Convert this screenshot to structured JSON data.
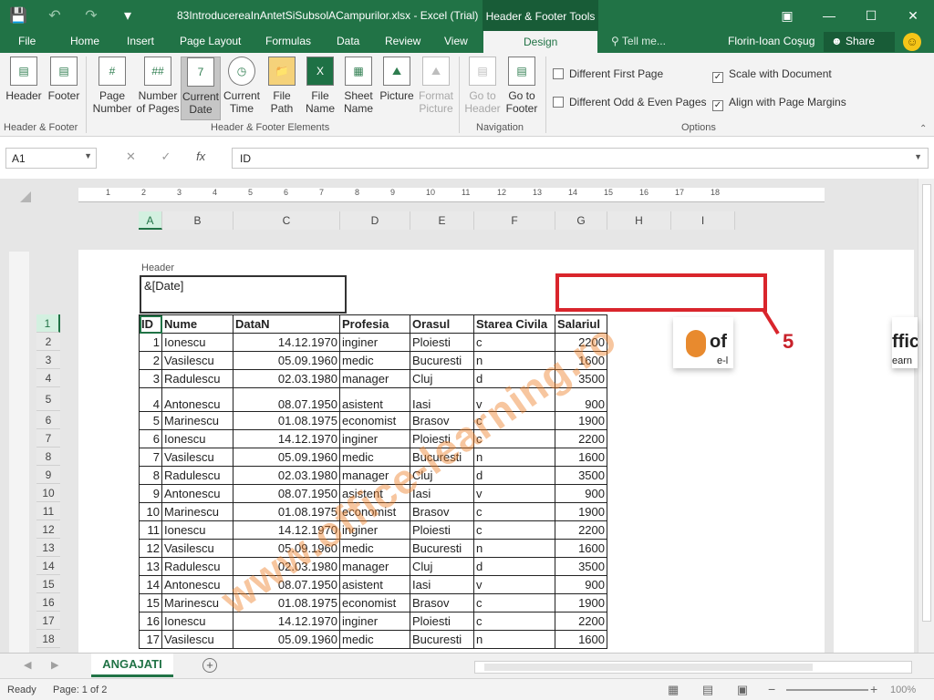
{
  "window": {
    "title": "83IntroducereaInAntetSiSubsolACampurilor.xlsx - Excel (Trial)",
    "contextual_tab": "Header & Footer Tools"
  },
  "tabs": [
    "File",
    "Home",
    "Insert",
    "Page Layout",
    "Formulas",
    "Data",
    "Review",
    "View",
    "Design"
  ],
  "tell_me": "Tell me...",
  "user": "Florin-Ioan Coşug",
  "share": "Share",
  "ribbon": {
    "groups": {
      "hf": "Header & Footer",
      "elements": "Header & Footer Elements",
      "navigation": "Navigation",
      "options": "Options"
    },
    "buttons": {
      "header": "Header",
      "footer": "Footer",
      "page_number": "Page Number",
      "number_of_pages": "Number of Pages",
      "current_date": "Current Date",
      "current_time": "Current Time",
      "file_path": "File Path",
      "file_name": "File Name",
      "sheet_name": "Sheet Name",
      "picture": "Picture",
      "format_picture": "Format Picture",
      "go_to_header": "Go to Header",
      "go_to_footer": "Go to Footer"
    },
    "options": {
      "different_first_page": "Different First Page",
      "different_odd_even": "Different Odd & Even Pages",
      "scale_with_document": "Scale with Document",
      "align_with_margins": "Align with Page Margins"
    }
  },
  "formula_bar": {
    "name_box": "A1",
    "value": "ID"
  },
  "columns": [
    "A",
    "B",
    "C",
    "D",
    "E",
    "F",
    "G",
    "H",
    "I"
  ],
  "ruler_ticks": [
    "1",
    "2",
    "3",
    "4",
    "5",
    "6",
    "7",
    "8",
    "9",
    "10",
    "11",
    "12",
    "13",
    "14",
    "15",
    "16",
    "17",
    "18"
  ],
  "header_label": "Header",
  "header_left_content": "&[Date]",
  "callout_number": "5",
  "table": {
    "headers": [
      "ID",
      "Nume",
      "DataN",
      "Profesia",
      "Orasul",
      "Starea Civila",
      "Salariul"
    ],
    "rows": [
      [
        "1",
        "Ionescu",
        "14.12.1970",
        "inginer",
        "Ploiesti",
        "c",
        "2200"
      ],
      [
        "2",
        "Vasilescu",
        "05.09.1960",
        "medic",
        "Bucuresti",
        "n",
        "1600"
      ],
      [
        "3",
        "Radulescu",
        "02.03.1980",
        "manager",
        "Cluj",
        "d",
        "3500"
      ],
      [
        "4",
        "Antonescu",
        "08.07.1950",
        "asistent",
        "Iasi",
        "v",
        "900"
      ],
      [
        "5",
        "Marinescu",
        "01.08.1975",
        "economist",
        "Brasov",
        "c",
        "1900"
      ],
      [
        "6",
        "Ionescu",
        "14.12.1970",
        "inginer",
        "Ploiesti",
        "c",
        "2200"
      ],
      [
        "7",
        "Vasilescu",
        "05.09.1960",
        "medic",
        "Bucuresti",
        "n",
        "1600"
      ],
      [
        "8",
        "Radulescu",
        "02.03.1980",
        "manager",
        "Cluj",
        "d",
        "3500"
      ],
      [
        "9",
        "Antonescu",
        "08.07.1950",
        "asistent",
        "Iasi",
        "v",
        "900"
      ],
      [
        "10",
        "Marinescu",
        "01.08.1975",
        "economist",
        "Brasov",
        "c",
        "1900"
      ],
      [
        "11",
        "Ionescu",
        "14.12.1970",
        "inginer",
        "Ploiesti",
        "c",
        "2200"
      ],
      [
        "12",
        "Vasilescu",
        "05.09.1960",
        "medic",
        "Bucuresti",
        "n",
        "1600"
      ],
      [
        "13",
        "Radulescu",
        "02.03.1980",
        "manager",
        "Cluj",
        "d",
        "3500"
      ],
      [
        "14",
        "Antonescu",
        "08.07.1950",
        "asistent",
        "Iasi",
        "v",
        "900"
      ],
      [
        "15",
        "Marinescu",
        "01.08.1975",
        "economist",
        "Brasov",
        "c",
        "1900"
      ],
      [
        "16",
        "Ionescu",
        "14.12.1970",
        "inginer",
        "Ploiesti",
        "c",
        "2200"
      ],
      [
        "17",
        "Vasilescu",
        "05.09.1960",
        "medic",
        "Bucuresti",
        "n",
        "1600"
      ]
    ]
  },
  "row_numbers": [
    "1",
    "2",
    "3",
    "4",
    "5",
    "6",
    "7",
    "8",
    "9",
    "10",
    "11",
    "12",
    "13",
    "14",
    "15",
    "16",
    "17",
    "18"
  ],
  "logo": {
    "text": "of",
    "sub": "e-l",
    "text2": "ffic",
    "sub2": "earn"
  },
  "watermark": "www.office-learning.ro",
  "sheet_tab": "ANGAJATI",
  "status": {
    "ready": "Ready",
    "page": "Page: 1 of 2",
    "zoom": "100%"
  },
  "colors": {
    "excel_green": "#217346",
    "dark_green": "#185c37",
    "callout_red": "#d9252c",
    "watermark_orange": "#ee802a"
  }
}
